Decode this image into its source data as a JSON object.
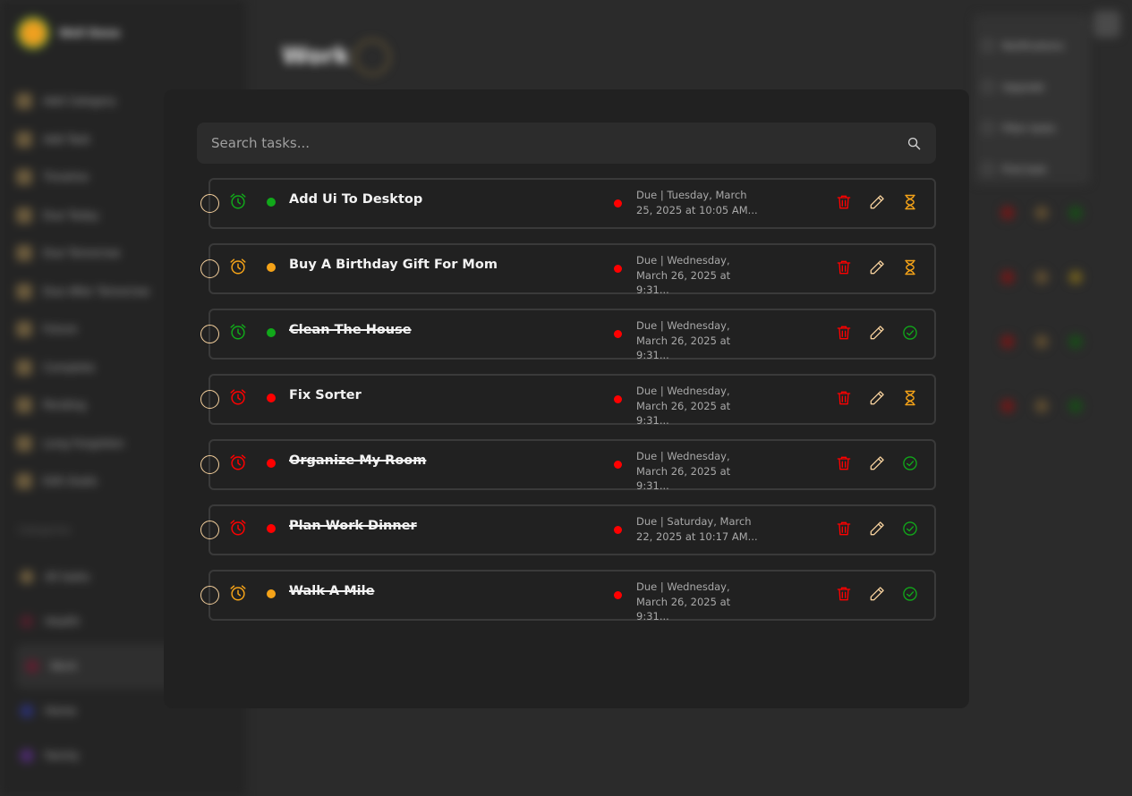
{
  "app": {
    "name": "Well Done"
  },
  "sidebar": {
    "items": [
      {
        "label": "Add Category"
      },
      {
        "label": "Add Task"
      },
      {
        "label": "Timeline"
      },
      {
        "label": "Due Today"
      },
      {
        "label": "Due Tomorrow"
      },
      {
        "label": "Due After Tomorrow"
      },
      {
        "label": "Future"
      },
      {
        "label": "Complete"
      },
      {
        "label": "Pending"
      },
      {
        "label": "Long Forgotten"
      },
      {
        "label": "Edit Goals"
      }
    ],
    "categories_heading": "Categories",
    "categories": [
      {
        "label": "All tasks",
        "color": "#6a5a3c"
      },
      {
        "label": "Health",
        "color": "#4a1f2a"
      },
      {
        "label": "Work",
        "color": "#5a1f2f"
      },
      {
        "label": "Home",
        "color": "#2a2f6a"
      },
      {
        "label": "Family",
        "color": "#4a2a6a"
      }
    ]
  },
  "page": {
    "title": "Work"
  },
  "right_menu": {
    "items": [
      {
        "label": "Notifications"
      },
      {
        "label": "Upgrade"
      },
      {
        "label": "Filter tasks"
      },
      {
        "label": "Find task"
      }
    ]
  },
  "modal": {
    "search": {
      "placeholder": "Search tasks..."
    },
    "colors": {
      "red": "#ff0000",
      "orange": "#f5a318",
      "green": "#11a81a",
      "peach": "#f4cf9c"
    },
    "tasks": [
      {
        "title": "Add Ui To Desktop",
        "done": false,
        "alarm_color": "#11a81a",
        "priority_color": "#11a81a",
        "due": "Due | Tuesday, March 25, 2025 at 10:05 AM...",
        "status_icon": "hourglass-icon"
      },
      {
        "title": "Buy A Birthday Gift For Mom",
        "done": false,
        "alarm_color": "#f5a318",
        "priority_color": "#f5a318",
        "due": "Due | Wednesday, March 26, 2025 at 9:31...",
        "status_icon": "hourglass-icon"
      },
      {
        "title": "Clean The House",
        "done": true,
        "alarm_color": "#11a81a",
        "priority_color": "#11a81a",
        "due": "Due | Wednesday, March 26, 2025 at 9:31...",
        "status_icon": "check-circle-icon"
      },
      {
        "title": "Fix Sorter",
        "done": false,
        "alarm_color": "#ff0000",
        "priority_color": "#ff0000",
        "due": "Due | Wednesday, March 26, 2025 at 9:31...",
        "status_icon": "hourglass-icon"
      },
      {
        "title": "Organize My Room",
        "done": true,
        "alarm_color": "#ff0000",
        "priority_color": "#ff0000",
        "due": "Due | Wednesday, March 26, 2025 at 9:31...",
        "status_icon": "check-circle-icon"
      },
      {
        "title": "Plan Work Dinner",
        "done": true,
        "alarm_color": "#ff0000",
        "priority_color": "#ff0000",
        "due": "Due | Saturday, March 22, 2025 at 10:17 AM...",
        "status_icon": "check-circle-icon"
      },
      {
        "title": "Walk A Mile",
        "done": true,
        "alarm_color": "#f5a318",
        "priority_color": "#f5a318",
        "due": "Due | Wednesday, March 26, 2025 at 9:31...",
        "status_icon": "check-circle-icon"
      }
    ]
  }
}
